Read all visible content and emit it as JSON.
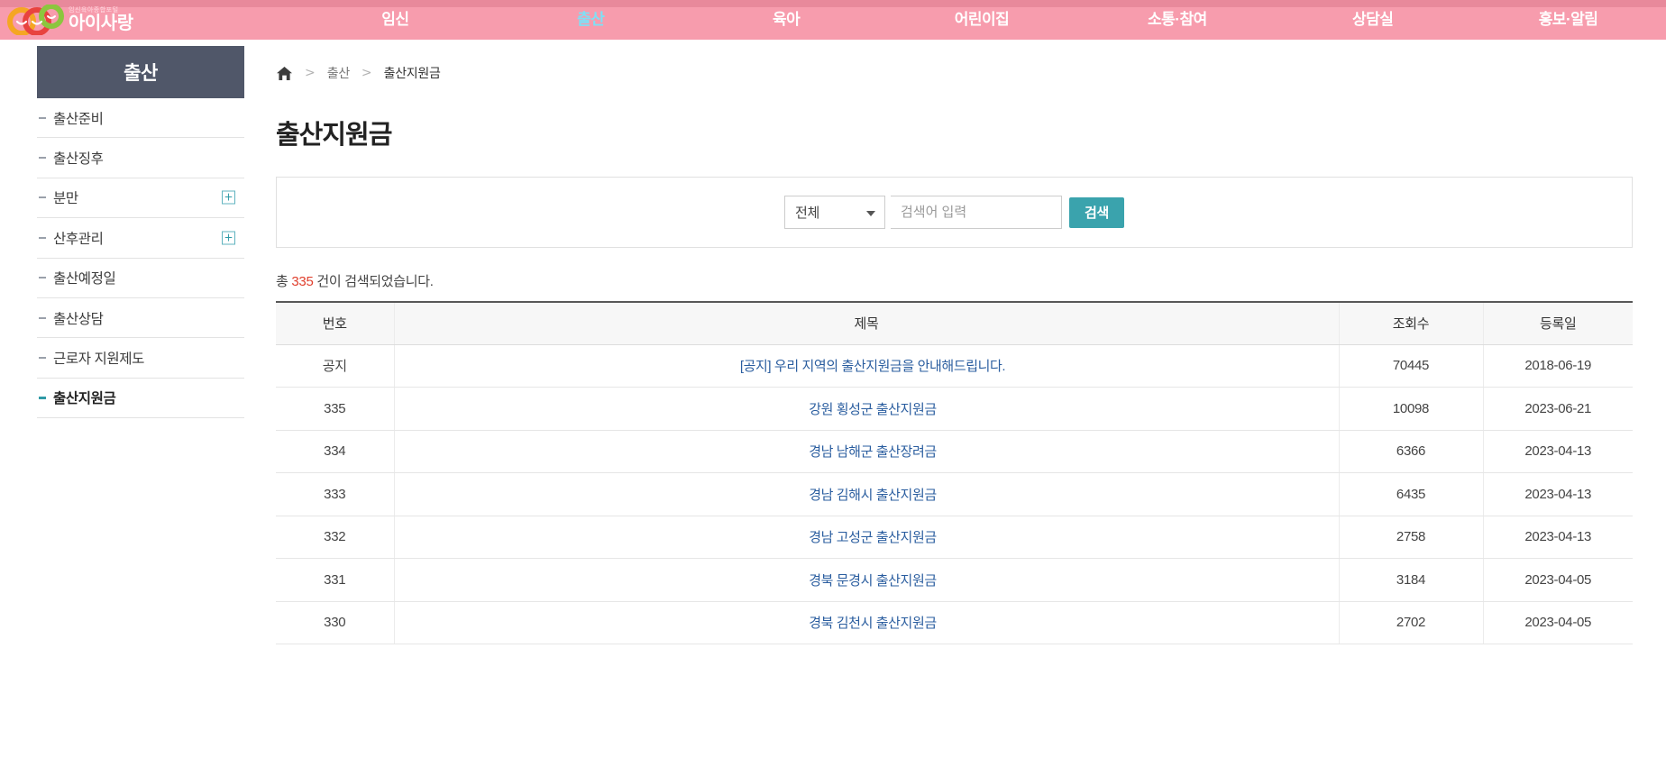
{
  "header": {
    "logo": {
      "tagline": "임신육아종합포털",
      "title": "아이사랑",
      "colors": [
        "#f5a623",
        "#e8433f",
        "#8cc63e"
      ]
    },
    "nav": [
      {
        "label": "임신",
        "active": false
      },
      {
        "label": "출산",
        "active": true
      },
      {
        "label": "육아",
        "active": false
      },
      {
        "label": "어린이집",
        "active": false
      },
      {
        "label": "소통·참여",
        "active": false
      },
      {
        "label": "상담실",
        "active": false
      },
      {
        "label": "홍보·알림",
        "active": false
      }
    ],
    "bar_color": "#f79cad",
    "active_color": "#7fe0f5"
  },
  "sidebar": {
    "title": "출산",
    "title_bg": "#505769",
    "items": [
      {
        "label": "출산준비",
        "expandable": false,
        "active": false
      },
      {
        "label": "출산징후",
        "expandable": false,
        "active": false
      },
      {
        "label": "분만",
        "expandable": true,
        "active": false,
        "expand_icon": "plus-icon"
      },
      {
        "label": "산후관리",
        "expandable": true,
        "active": false,
        "expand_icon": "plus-icon"
      },
      {
        "label": "출산예정일",
        "expandable": false,
        "active": false
      },
      {
        "label": "출산상담",
        "expandable": false,
        "active": false
      },
      {
        "label": "근로자 지원제도",
        "expandable": false,
        "active": false
      },
      {
        "label": "출산지원금",
        "expandable": false,
        "active": true
      }
    ]
  },
  "breadcrumb": {
    "home_icon": "home-icon",
    "separator": ">",
    "items": [
      "출산",
      "출산지원금"
    ]
  },
  "main": {
    "page_title": "출산지원금",
    "search": {
      "category_selected": "전체",
      "category_caret": "chevron-down-icon",
      "keyword_value": "",
      "keyword_placeholder": "검색어 입력",
      "button_label": "검색",
      "button_color": "#3aa3ad"
    },
    "result_text_prefix": "총 ",
    "result_count": "335",
    "result_text_suffix": " 건이 검색되었습니다.",
    "table": {
      "columns": [
        "번호",
        "제목",
        "조회수",
        "등록일"
      ],
      "rows": [
        {
          "no": "공지",
          "title": "[공지] 우리 지역의 출산지원금을 안내해드립니다.",
          "views": "70445",
          "date": "2018-06-19"
        },
        {
          "no": "335",
          "title": "강원 횡성군 출산지원금",
          "views": "10098",
          "date": "2023-06-21"
        },
        {
          "no": "334",
          "title": "경남 남해군 출산장려금",
          "views": "6366",
          "date": "2023-04-13"
        },
        {
          "no": "333",
          "title": "경남 김해시 출산지원금",
          "views": "6435",
          "date": "2023-04-13"
        },
        {
          "no": "332",
          "title": "경남 고성군 출산지원금",
          "views": "2758",
          "date": "2023-04-13"
        },
        {
          "no": "331",
          "title": "경북 문경시 출산지원금",
          "views": "3184",
          "date": "2023-04-05"
        },
        {
          "no": "330",
          "title": "경북 김천시 출산지원금",
          "views": "2702",
          "date": "2023-04-05"
        }
      ]
    }
  }
}
